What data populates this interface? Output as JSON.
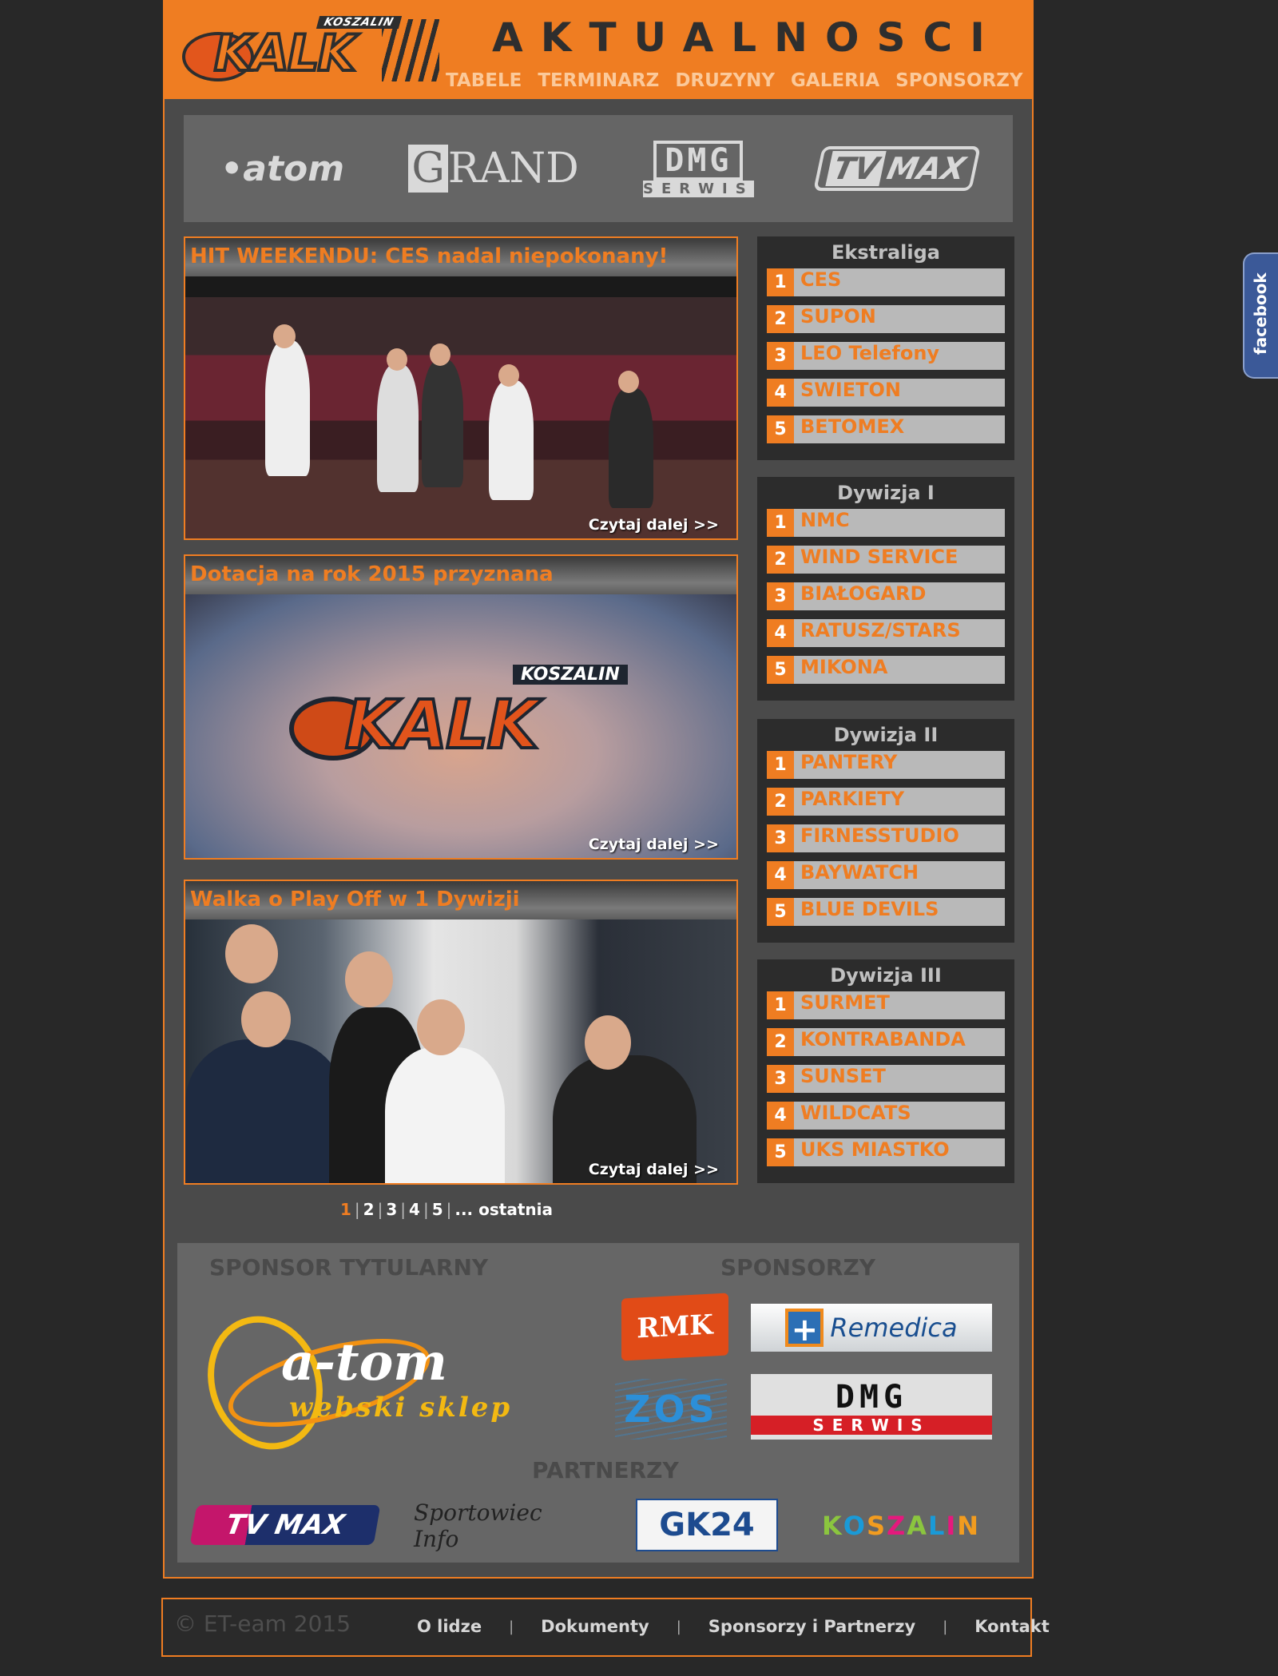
{
  "header": {
    "logo_top": "KOSZALIN",
    "logo_main": "KALK",
    "title": "AKTUALNOSCI",
    "nav": [
      "TABELE",
      "TERMINARZ",
      "DRUZYNY",
      "GALERIA",
      "SPONSORZY"
    ]
  },
  "top_sponsors": {
    "atom": "atom",
    "grand_g": "G",
    "grand_rest": "RAND",
    "dmg_top": "DMG",
    "dmg_bottom": "SERWIS",
    "tvmax_tv": "TV",
    "tvmax_max": "MAX"
  },
  "news": [
    {
      "title": "HIT WEEKENDU: CES nadal niepokonany!",
      "more": "Czytaj dalej >>"
    },
    {
      "title": "Dotacja na rok 2015 przyznana",
      "more": "Czytaj dalej >>",
      "logo_top": "KOSZALIN",
      "logo_main": "KALK"
    },
    {
      "title": "Walka o Play Off w 1 Dywizji",
      "more": "Czytaj dalej >>"
    }
  ],
  "pager": {
    "current": "1",
    "pages": [
      "2",
      "3",
      "4",
      "5"
    ],
    "last": "... ostatnia"
  },
  "tables": [
    {
      "title": "Ekstraliga",
      "rows": [
        {
          "pos": "1",
          "team": "CES"
        },
        {
          "pos": "2",
          "team": "SUPON"
        },
        {
          "pos": "3",
          "team": "LEO Telefony"
        },
        {
          "pos": "4",
          "team": "SWIETON"
        },
        {
          "pos": "5",
          "team": "BETOMEX"
        }
      ]
    },
    {
      "title": "Dywizja I",
      "rows": [
        {
          "pos": "1",
          "team": "NMC"
        },
        {
          "pos": "2",
          "team": "WIND SERVICE"
        },
        {
          "pos": "3",
          "team": "BIAŁOGARD"
        },
        {
          "pos": "4",
          "team": "RATUSZ/STARS"
        },
        {
          "pos": "5",
          "team": "MIKONA"
        }
      ]
    },
    {
      "title": "Dywizja II",
      "rows": [
        {
          "pos": "1",
          "team": "PANTERY"
        },
        {
          "pos": "2",
          "team": "PARKIETY"
        },
        {
          "pos": "3",
          "team": "FIRNESSTUDIO"
        },
        {
          "pos": "4",
          "team": "BAYWATCH"
        },
        {
          "pos": "5",
          "team": "BLUE DEVILS"
        }
      ]
    },
    {
      "title": "Dywizja III",
      "rows": [
        {
          "pos": "1",
          "team": "SURMET"
        },
        {
          "pos": "2",
          "team": "KONTRABANDA"
        },
        {
          "pos": "3",
          "team": "SUNSET"
        },
        {
          "pos": "4",
          "team": "WILDCATS"
        },
        {
          "pos": "5",
          "team": "UKS MIASTKO"
        }
      ]
    }
  ],
  "sponsor_panel": {
    "title_sponsor_heading": "SPONSOR TYTULARNY",
    "sponsors_heading": "SPONSORZY",
    "partners_heading": "PARTNERZY",
    "atom_main": "a-tom",
    "atom_sub": "webski sklep",
    "rmk": "RMK",
    "remedica": "Remedica",
    "zos": "ZOS",
    "dmg_top": "DMG",
    "dmg_bottom": "SERWIS",
    "tvmax": "TV MAX",
    "sportowiec": "Sportowiec Info",
    "gk24": "GK24",
    "koszalin_letters": [
      "K",
      "O",
      "S",
      "Z",
      "A",
      "L",
      "I",
      "N"
    ]
  },
  "footer": {
    "copyright": "© ET-eam 2015",
    "links": [
      "O lidze",
      "Dokumenty",
      "Sponsorzy i Partnerzy",
      "Kontakt"
    ],
    "separator": "|"
  },
  "facebook": {
    "label": "facebook"
  },
  "colors": {
    "accent": "#ef7d22",
    "background": "#282828",
    "panel": "#4a4a4a"
  }
}
